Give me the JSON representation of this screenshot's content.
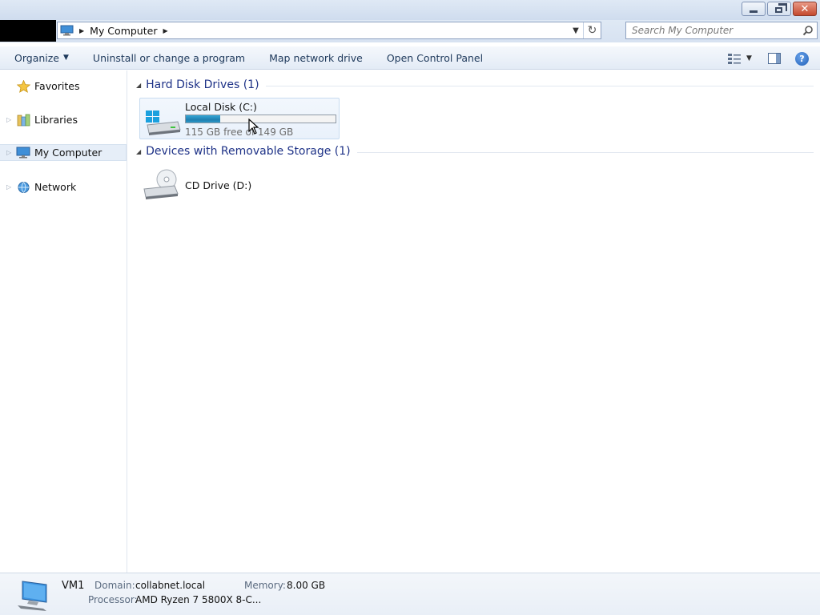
{
  "window": {
    "minimize_glyph": "—",
    "close_glyph": "✕"
  },
  "address_bar": {
    "location": "My Computer",
    "search_placeholder": "Search My Computer"
  },
  "toolbar": {
    "organize_label": "Organize",
    "uninstall_label": "Uninstall or change a program",
    "map_drive_label": "Map network drive",
    "control_panel_label": "Open Control Panel",
    "help_glyph": "?"
  },
  "nav": {
    "items": [
      {
        "label": "Favorites",
        "icon": "star-icon"
      },
      {
        "label": "Libraries",
        "icon": "libraries-icon"
      },
      {
        "label": "My Computer",
        "icon": "computer-icon",
        "selected": true
      },
      {
        "label": "Network",
        "icon": "network-icon"
      }
    ]
  },
  "content": {
    "hard_disk_group_title": "Hard Disk Drives (1)",
    "removable_group_title": "Devices with Removable Storage (1)",
    "local_disk": {
      "name": "Local Disk (C:)",
      "free_text": "115 GB free of 149 GB",
      "used_fraction": 0.23
    },
    "cd_drive": {
      "name": "CD Drive (D:)"
    }
  },
  "details": {
    "computer_name": "VM1",
    "domain_label": "Domain:",
    "domain_value": "collabnet.local",
    "memory_label": "Memory:",
    "memory_value": "8.00 GB",
    "processor_label": "Processor:",
    "processor_value": "AMD Ryzen 7 5800X 8-C..."
  },
  "colors": {
    "accent_blue": "#1e3287",
    "progress_fill": "#2d97c7"
  }
}
